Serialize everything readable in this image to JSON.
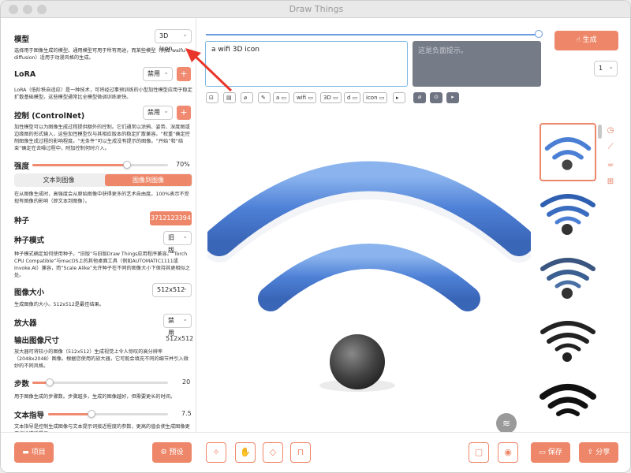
{
  "window": {
    "title": "Draw Things"
  },
  "left": {
    "model": {
      "label": "模型",
      "value": "3D icon",
      "desc": "选择用于图像生成的模型。通用模型可用于所有用途，而某些模型（例如 waifu-diffusion）适用于动漫风格的生成。"
    },
    "lora": {
      "label": "LoRA",
      "value": "禁用",
      "desc": "LoRA（低阶秩自适应）是一种技术，可将经过事预训练的小型加性模型应用于稳定扩散基础模型。这些模型通常比全模型微调训练更快。"
    },
    "control": {
      "label": "控制 (ControlNet)",
      "value": "禁用",
      "desc": "加性模型可以为图像生成过程提供额外的控制。它们通常以涂鸦、姿势、深度图或边缘图的形式输入，这些加性模型仅与其相应版本的稳定扩散兼容。“权重”确定控制图像生成过程的影响程度。“无条件”可以生成没有提示的图像。“开始”和“结束”确定在去噪过程中，附加控制何时介入。"
    },
    "strength": {
      "label": "强度",
      "value": "70%",
      "level": 0.7
    },
    "modes": {
      "txt2img": "文本到图像",
      "img2img": "图像到图像"
    },
    "mode_desc": "在从图像生成时，高强度会从原始图像中获得更多的艺术自由度。100%表示不受现有图像的影响（即文本到图像）。",
    "seed": {
      "label": "种子",
      "value": "3712123394"
    },
    "seed_mode": {
      "label": "种子模式",
      "value": "旧版",
      "desc": "种子模式确定如何使用种子。“旧版”与旧版Draw Things应用程序兼容。“Torch CPU Compatible”与macOS上的其他桌面工具（例如AUTOMATIC1111或Invoke.AI）兼容，而“Scale Alike”允许种子在不同的图像大小下保持其更相似之处。"
    },
    "image_size": {
      "label": "图像大小",
      "value": "512x512",
      "desc": "生成图像的大小。512x512是最佳结果。"
    },
    "upscaler": {
      "label": "放大器",
      "value": "禁用"
    },
    "output_size": {
      "label": "输出图像尺寸",
      "value": "512x512",
      "desc": "放大器可将较小的图像（512x512）生成视觉上令人惊叹的高分辨率（2048x2048）图像。根据您使用的放大器，它可能会填充不同的细节并引入微妙的不同风格。"
    },
    "steps": {
      "label": "步数",
      "value": "20",
      "level": 0.13,
      "desc": "用于图像生成的步骤数。步骤越多，生成的图像越好，但需要更长的时间。"
    },
    "guidance": {
      "label": "文本指导",
      "value": "7.5",
      "level": 0.36,
      "desc": "文本指导是控制生成图像与文本提示词接近程度的参数，更高的值会使生成图像更严格地遵循提示。"
    }
  },
  "prompt": {
    "text": "a wifi 3D icon",
    "negative_placeholder": "这是负面提示。"
  },
  "prompt_tokens": [
    "a",
    "wifi",
    "3D",
    "d",
    "icon"
  ],
  "generate": {
    "label": "生成",
    "count": "1"
  },
  "bottom": {
    "project": "项目",
    "preset": "预设",
    "save": "保存",
    "share": "分享"
  },
  "colors": {
    "accent": "#ee8769",
    "wifi_blue": "#4a7fd4",
    "dark": "#2a2a2a"
  }
}
